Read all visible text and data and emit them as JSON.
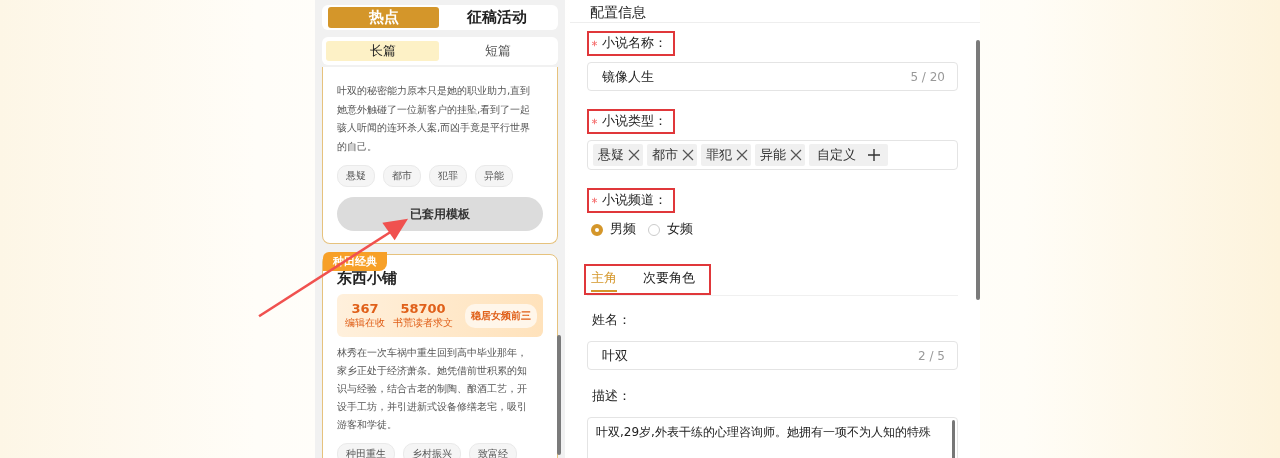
{
  "top_tabs": [
    {
      "label": "热点",
      "selected": true
    },
    {
      "label": "征稿活动",
      "selected": false
    }
  ],
  "sub_tabs": [
    {
      "label": "长篇",
      "selected": true
    },
    {
      "label": "短篇",
      "selected": false
    }
  ],
  "cards": [
    {
      "description": "叶双的秘密能力原本只是她的职业助力,直到她意外触碰了一位新客户的挂坠,看到了一起骇人听闻的连环杀人案,而凶手竟是平行世界的自己。",
      "tags": [
        "悬疑",
        "都市",
        "犯罪",
        "异能"
      ],
      "button": "已套用模板"
    },
    {
      "badge": "种田经典",
      "title": "东西小铺",
      "stats": [
        {
          "value": "367",
          "label": "编辑在收"
        },
        {
          "value": "58700",
          "label": "书荒读者求文"
        }
      ],
      "highlight": "稳居女频前三",
      "description": "林秀在一次车祸中重生回到高中毕业那年，家乡正处于经济萧条。她凭借前世积累的知识与经验，结合古老的制陶、酿酒工艺，开设手工坊，并引进新式设备修缮老宅，吸引游客和学徒。",
      "tags": [
        "种田重生",
        "乡村振兴",
        "致富经"
      ]
    }
  ],
  "config": {
    "title": "配置信息",
    "fields": [
      {
        "kind": "text",
        "label": "小说名称：",
        "required": true,
        "annotated": true,
        "value": "镜像人生",
        "count": "5 / 20"
      },
      {
        "kind": "tags",
        "label": "小说类型：",
        "required": true,
        "annotated": true,
        "tags": [
          "悬疑",
          "都市",
          "罪犯",
          "异能"
        ],
        "add_label": "自定义"
      },
      {
        "kind": "radio",
        "label": "小说频道：",
        "required": true,
        "annotated": true,
        "options": [
          {
            "label": "男频",
            "selected": true
          },
          {
            "label": "女频",
            "selected": false
          }
        ]
      }
    ],
    "role_tabs": {
      "annotated": true,
      "tabs": [
        {
          "label": "主角",
          "selected": true
        },
        {
          "label": "次要角色",
          "selected": false
        }
      ]
    },
    "role_fields": [
      {
        "kind": "text",
        "label": "姓名：",
        "value": "叶双",
        "count": "2 / 5"
      },
      {
        "kind": "textarea",
        "label": "描述：",
        "value": "叶双,29岁,外表干练的心理咨询师。她拥有一项不为人知的特殊"
      }
    ]
  },
  "pointer_arrow": true
}
